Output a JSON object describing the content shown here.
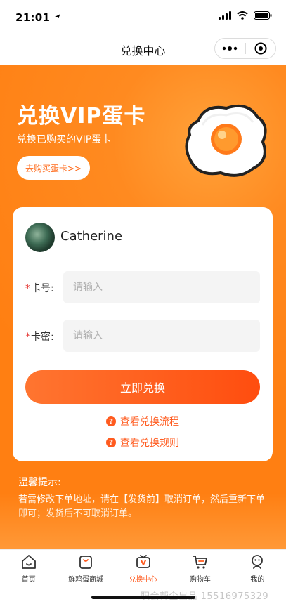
{
  "status_bar": {
    "time": "21:01"
  },
  "nav": {
    "title": "兑换中心"
  },
  "hero": {
    "title": "兑换VIP蛋卡",
    "subtitle": "兑换已购买的VIP蛋卡",
    "buy_button": "去购买蛋卡>>"
  },
  "card": {
    "user_name": "Catherine",
    "fields": [
      {
        "label": "卡号:",
        "placeholder": "请输入"
      },
      {
        "label": "卡密:",
        "placeholder": "请输入"
      }
    ],
    "required_mark": "*",
    "redeem_button": "立即兑换",
    "links": [
      "查看兑换流程",
      "查看兑换规则"
    ],
    "help_glyph": "?"
  },
  "tips": {
    "title": "温馨提示:",
    "text": "若需修改下单地址，请在【发货前】取消订单，然后重新下单即可；发货后不可取消订单。"
  },
  "tabbar": {
    "items": [
      {
        "label": "首页",
        "icon": "home-icon"
      },
      {
        "label": "鲜鸡蛋商城",
        "icon": "shopping-bag-icon"
      },
      {
        "label": "兑换中心",
        "icon": "exchange-card-icon",
        "active": true
      },
      {
        "label": "购物车",
        "icon": "cart-icon"
      },
      {
        "label": "我的",
        "icon": "profile-icon"
      }
    ]
  },
  "watermark": "职会帮企出品  15516975329",
  "colors": {
    "accent": "#ff5b1f",
    "hero_bg": "#ff8a20",
    "required": "#e53935"
  }
}
